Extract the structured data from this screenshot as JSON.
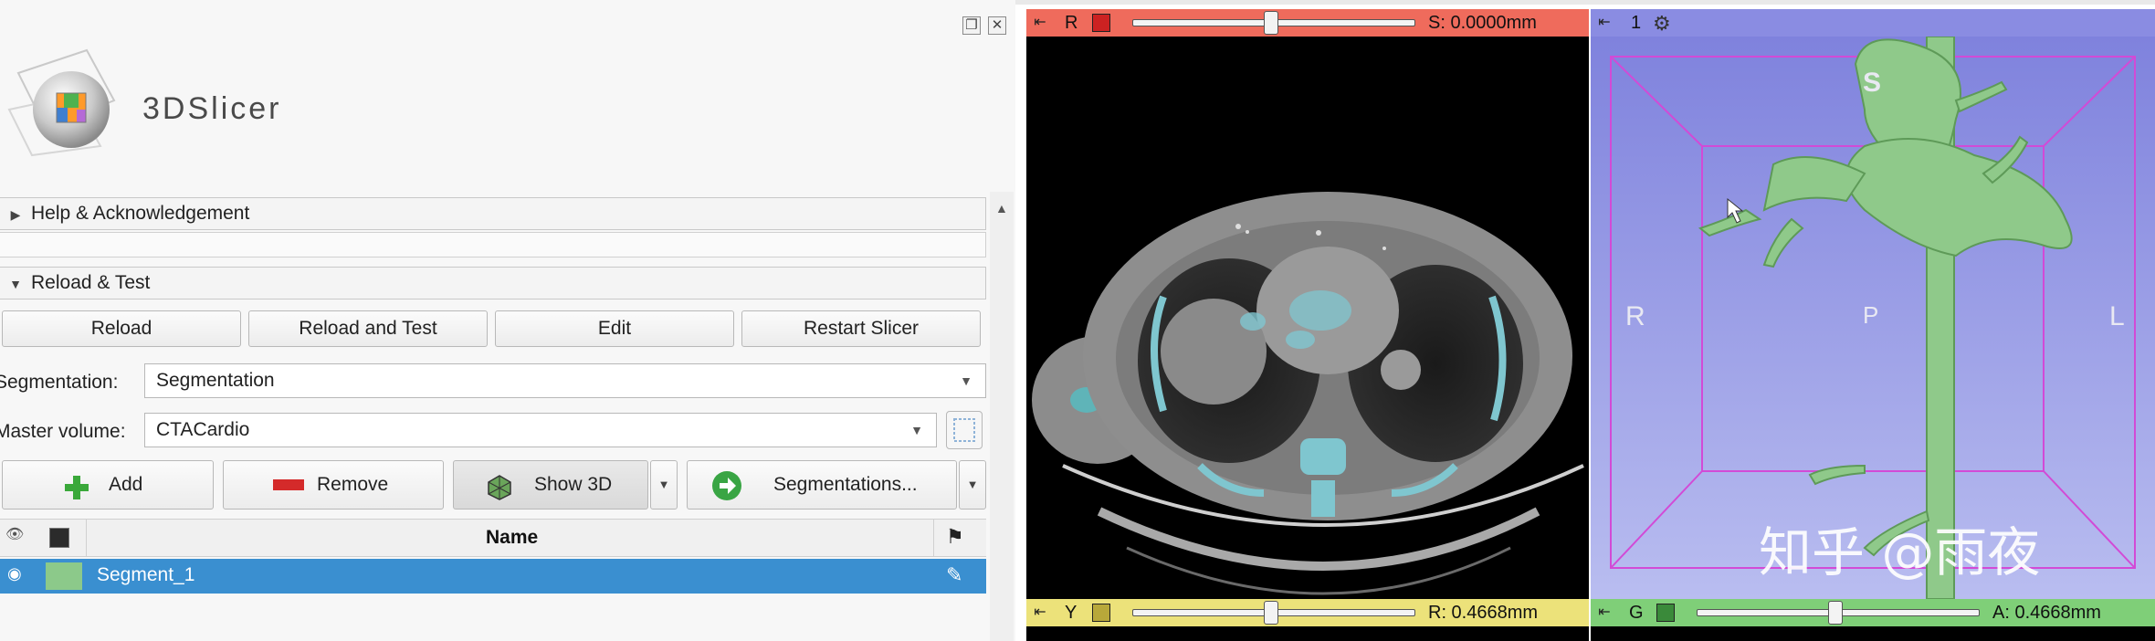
{
  "app": {
    "logo_text": "3DSlicer"
  },
  "sections": {
    "help": {
      "arrow": "▶",
      "label": "Help & Acknowledgement"
    },
    "reload": {
      "arrow": "▼",
      "label": "Reload & Test"
    }
  },
  "reload_buttons": {
    "reload": "Reload",
    "reload_and_test": "Reload and Test",
    "edit": "Edit",
    "restart": "Restart Slicer"
  },
  "segmentation": {
    "label": "Segmentation:",
    "value": "Segmentation"
  },
  "master_volume": {
    "label": "Master volume:",
    "value": "CTACardio"
  },
  "actions": {
    "add": "Add",
    "remove": "Remove",
    "show3d": "Show 3D",
    "segmentations": "Segmentations..."
  },
  "table": {
    "columns": [
      "Name"
    ],
    "rows": [
      {
        "name": "Segment_1"
      }
    ]
  },
  "viewers": {
    "red": {
      "pin": "⇤",
      "label": "R",
      "readout": "S: 0.0000mm",
      "slider_fraction": 0.49,
      "color": "#f06a5a"
    },
    "three_d": {
      "pin": "⇤",
      "label": "1",
      "color": "#8d8fe0",
      "orientation": {
        "top": "S",
        "left": "R",
        "center": "P",
        "right": "L"
      }
    },
    "yellow": {
      "pin": "⇤",
      "label": "Y",
      "readout": "R: 0.4668mm",
      "slider_fraction": 0.49,
      "color": "#ece27a"
    },
    "green": {
      "pin": "⇤",
      "label": "G",
      "readout": "A: 0.4668mm",
      "slider_fraction": 0.49,
      "color": "#7fcf78"
    }
  },
  "watermark": "知乎 @雨夜"
}
